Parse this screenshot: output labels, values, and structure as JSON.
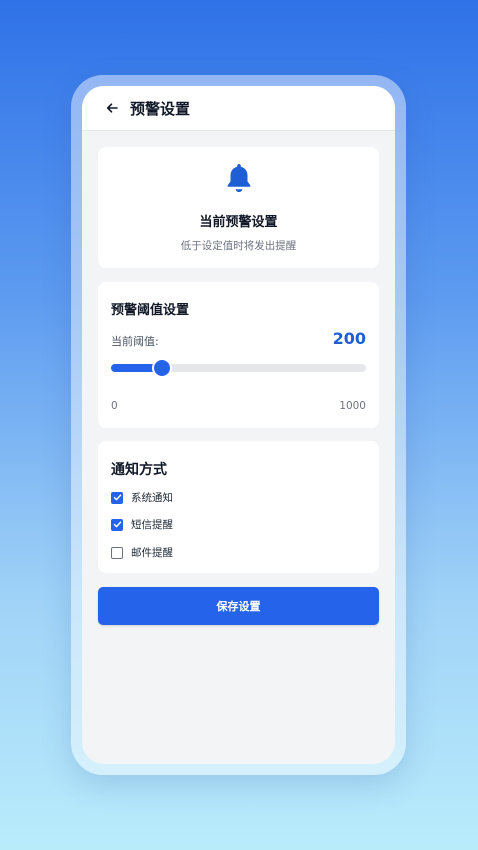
{
  "header": {
    "title": "预警设置",
    "back_icon": "arrow-left-icon"
  },
  "status_card": {
    "icon": "bell-icon",
    "title": "当前预警设置",
    "subtitle": "低于设定值时将发出提醒"
  },
  "threshold": {
    "title": "预警阈值设置",
    "label": "当前阈值:",
    "value": "200",
    "min": "0",
    "max": "1000",
    "current": 200
  },
  "notify": {
    "title": "通知方式",
    "options": [
      {
        "label": "系统通知",
        "checked": true
      },
      {
        "label": "短信提醒",
        "checked": true
      },
      {
        "label": "邮件提醒",
        "checked": false
      }
    ]
  },
  "actions": {
    "save_label": "保存设置"
  },
  "colors": {
    "accent": "#2563eb",
    "value": "#1f5fd6"
  }
}
